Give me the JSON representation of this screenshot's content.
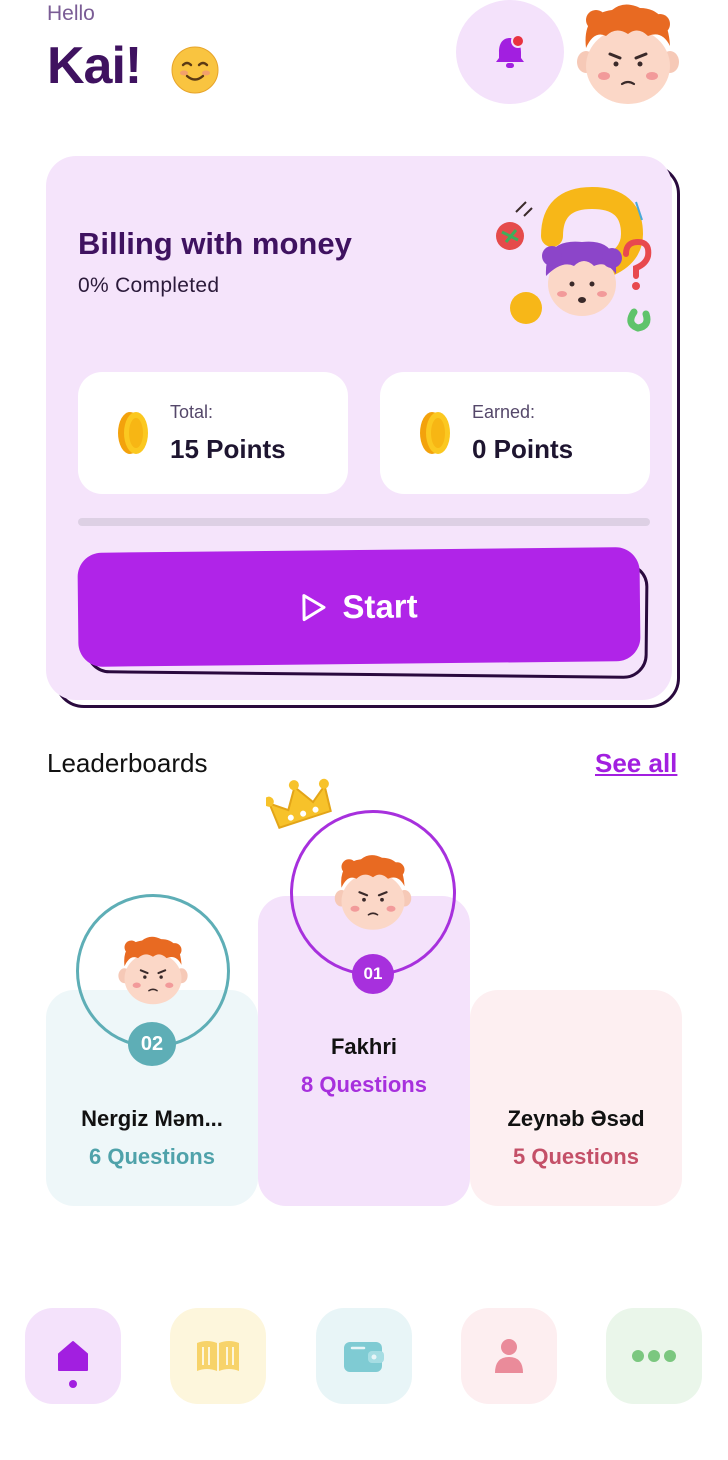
{
  "header": {
    "greeting": "Hello",
    "name": "Kai!",
    "emoji_icon": "smiling-face-icon",
    "notification_icon": "bell-icon"
  },
  "course_card": {
    "title": "Billing with money",
    "progress_text": "0% Completed",
    "progress_fraction": 0,
    "total_label": "Total:",
    "total_value": "15 Points",
    "earned_label": "Earned:",
    "earned_value": "0 Points",
    "start_label": "Start",
    "start_icon": "play-icon"
  },
  "leaderboards": {
    "title": "Leaderboards",
    "see_all": "See all",
    "entries": [
      {
        "rank": "01",
        "name": "Fakhri",
        "questions": "8 Questions"
      },
      {
        "rank": "02",
        "name": "Nergiz Məm...",
        "questions": "6 Questions"
      },
      {
        "rank": "",
        "name": "Zeynəb Əsəd",
        "questions": "5 Questions"
      }
    ]
  },
  "bottom_nav": {
    "items": [
      {
        "icon": "home-icon",
        "active": true
      },
      {
        "icon": "book-icon",
        "active": false
      },
      {
        "icon": "wallet-icon",
        "active": false
      },
      {
        "icon": "person-icon",
        "active": false
      },
      {
        "icon": "more-icon",
        "active": false
      }
    ]
  },
  "colors": {
    "accent": "#b024e8",
    "dark_purple": "#3f1260",
    "teal": "#5eaeb6",
    "rose": "#c45068"
  }
}
